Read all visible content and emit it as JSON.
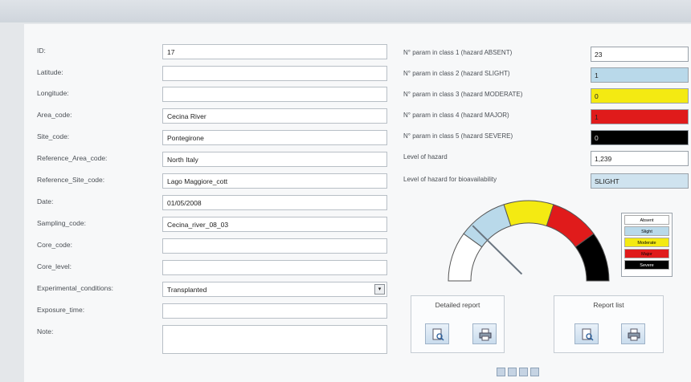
{
  "window": {
    "title": ""
  },
  "left_form": {
    "fields": [
      {
        "label": "ID:",
        "value": "17"
      },
      {
        "label": "Latitude:",
        "value": ""
      },
      {
        "label": "Longitude:",
        "value": ""
      },
      {
        "label": "Area_code:",
        "value": "Cecina River"
      },
      {
        "label": "Site_code:",
        "value": "Pontegirone"
      },
      {
        "label": "Reference_Area_code:",
        "value": "North Italy"
      },
      {
        "label": "Reference_Site_code:",
        "value": "Lago Maggiore_cott"
      },
      {
        "label": "Date:",
        "value": "01/05/2008"
      },
      {
        "label": "Sampling_code:",
        "value": "Cecina_river_08_03"
      },
      {
        "label": "Core_code:",
        "value": ""
      },
      {
        "label": "Core_level:",
        "value": ""
      },
      {
        "label": "Experimental_conditions:",
        "value": "Transplanted"
      },
      {
        "label": "Exposure_time:",
        "value": ""
      },
      {
        "label": "Note:",
        "value": ""
      }
    ],
    "dropdown_symbol": "▾"
  },
  "right_form": {
    "fields": [
      {
        "label": "N° param in class 1 (hazard ABSENT)",
        "value": "23"
      },
      {
        "label": "N° param in class 2 (hazard SLIGHT)",
        "value": "1"
      },
      {
        "label": "N° param in class 3 (hazard MODERATE)",
        "value": "0"
      },
      {
        "label": "N° param in class 4 (hazard MAJOR)",
        "value": "1"
      },
      {
        "label": "N° param in class 5 (hazard SEVERE)",
        "value": "0"
      },
      {
        "label": "Level of hazard",
        "value": "1,239"
      },
      {
        "label": "Level of hazard for bioavailability",
        "value": "SLIGHT"
      }
    ]
  },
  "gauge": {
    "level": 1.239,
    "max": 5,
    "segments": [
      {
        "color": "#ffffff"
      },
      {
        "color": "#b9d9ea"
      },
      {
        "color": "#f4ea12"
      },
      {
        "color": "#e01b1b"
      },
      {
        "color": "#000000"
      }
    ]
  },
  "legend": {
    "items": [
      {
        "label": "Absent",
        "color": "#ffffff",
        "text_color": "#000000"
      },
      {
        "label": "Slight",
        "color": "#b9d9ea",
        "text_color": "#000000"
      },
      {
        "label": "Moderate",
        "color": "#f4ea12",
        "text_color": "#000000"
      },
      {
        "label": "Major",
        "color": "#e01b1b",
        "text_color": "#000000"
      },
      {
        "label": "Severe",
        "color": "#000000",
        "text_color": "#ffffff"
      }
    ]
  },
  "detailed_report": {
    "title": "Detailed report",
    "preview_icon": "preview-icon",
    "print_icon": "print-icon"
  },
  "report_list": {
    "title": "Report list",
    "preview_icon": "preview-icon",
    "print_icon": "print-icon"
  },
  "colors": {
    "field_border": "#b8bfc6",
    "button_fill": "#c9dced"
  }
}
